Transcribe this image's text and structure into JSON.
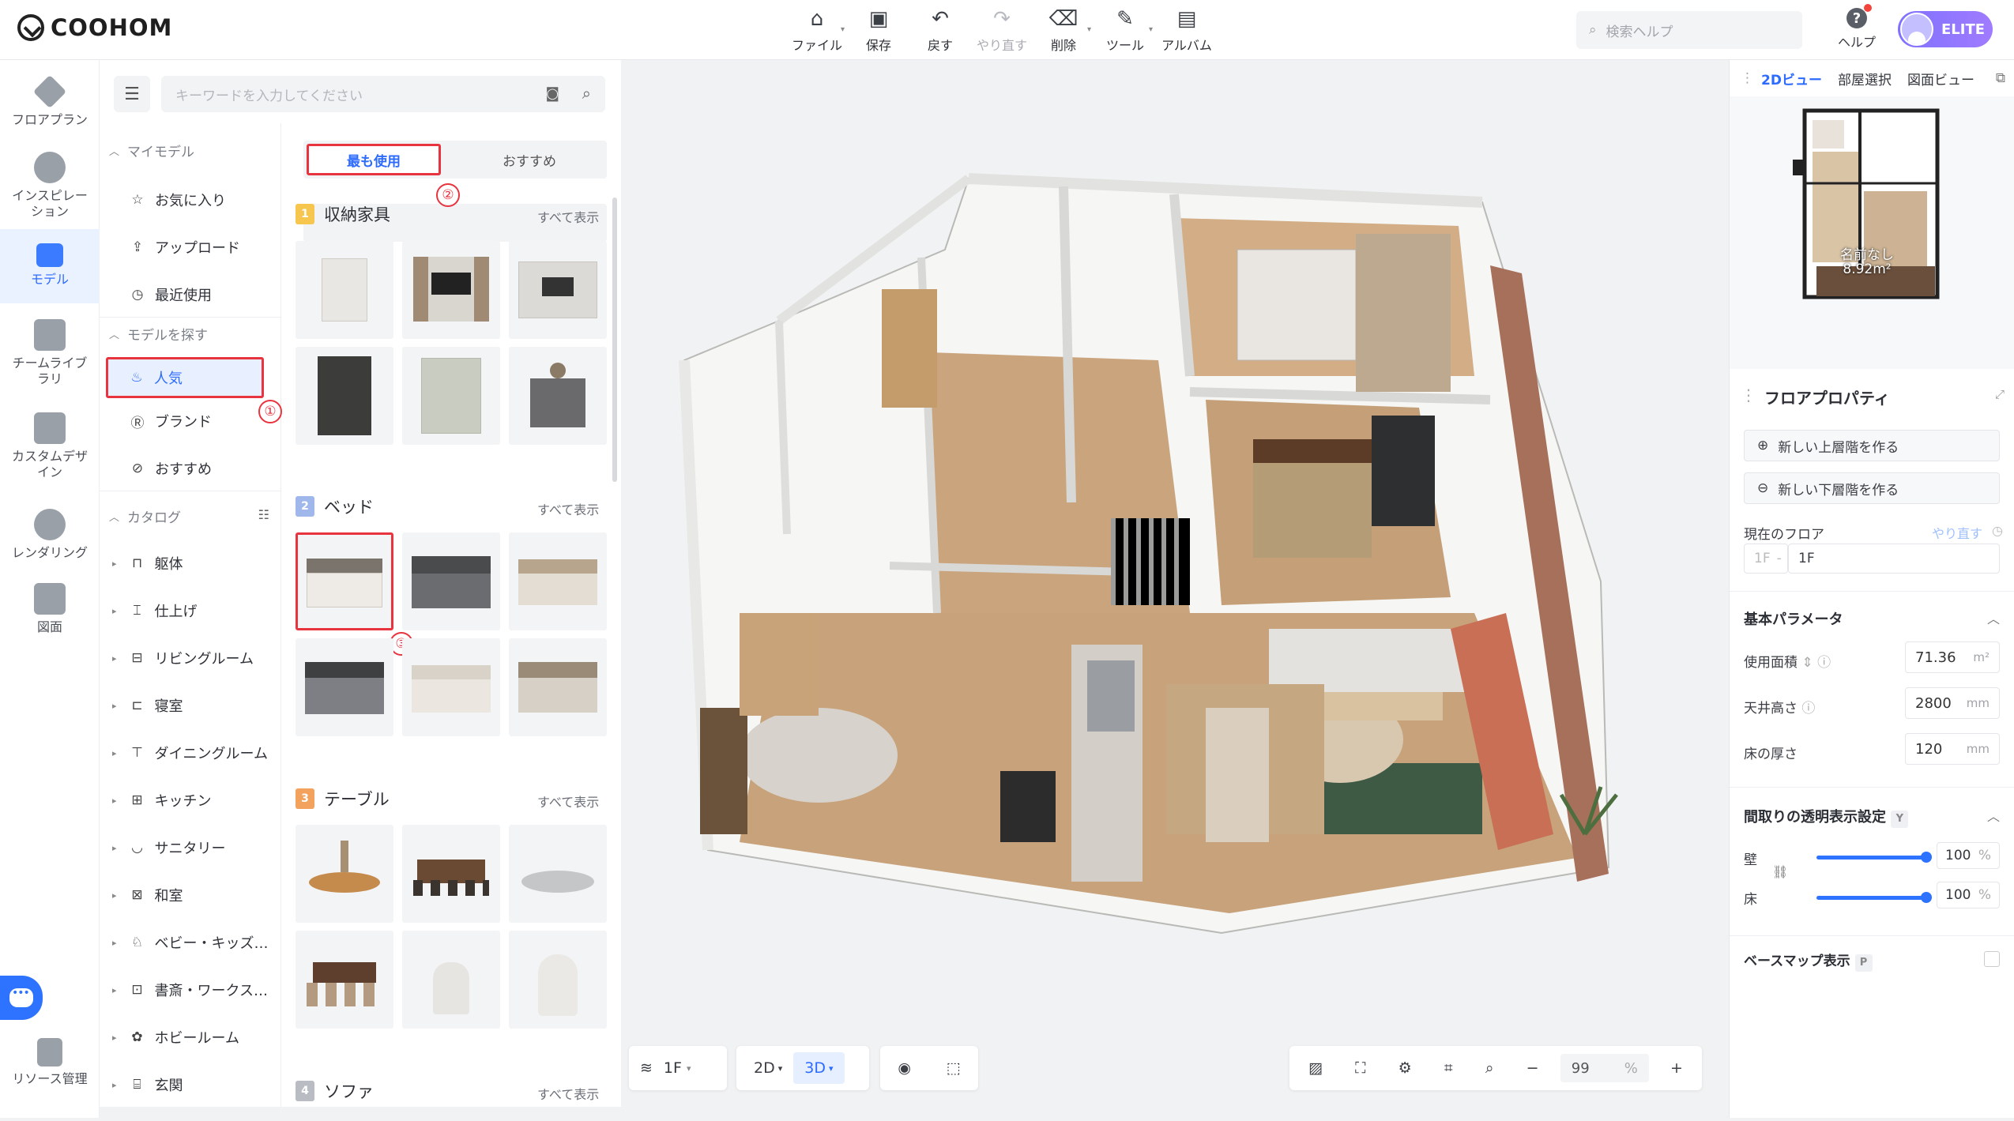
{
  "app": {
    "logo_text": "COOHOM"
  },
  "toolbar": {
    "items": [
      {
        "label": "ファイル",
        "icon": "home-file-icon",
        "dropdown": true,
        "disabled": false
      },
      {
        "label": "保存",
        "icon": "save-icon",
        "dropdown": false,
        "disabled": false
      },
      {
        "label": "戻す",
        "icon": "undo-icon",
        "dropdown": false,
        "disabled": false
      },
      {
        "label": "やり直す",
        "icon": "redo-icon",
        "dropdown": false,
        "disabled": true
      },
      {
        "label": "削除",
        "icon": "eraser-icon",
        "dropdown": true,
        "disabled": false
      },
      {
        "label": "ツール",
        "icon": "wrench-icon",
        "dropdown": true,
        "disabled": false
      },
      {
        "label": "アルバム",
        "icon": "album-icon",
        "dropdown": false,
        "disabled": false
      }
    ],
    "search_placeholder": "検索ヘルプ",
    "help_label": "ヘルプ",
    "badge": "ELITE"
  },
  "leftnav": {
    "items": [
      {
        "label": "フロアプラン",
        "icon": "floorplan-icon",
        "active": false
      },
      {
        "label": "インスピレーション",
        "icon": "lightbulb-icon",
        "active": false
      },
      {
        "label": "モデル",
        "icon": "sofa-icon",
        "active": true
      },
      {
        "label": "チームライブラリ",
        "icon": "crown-icon",
        "active": false
      },
      {
        "label": "カスタムデザイン",
        "icon": "box-icon",
        "active": false
      },
      {
        "label": "レンダリング",
        "icon": "camera-icon",
        "active": false
      },
      {
        "label": "図面",
        "icon": "drawing-icon",
        "active": false
      }
    ],
    "bottom_label": "リソース管理"
  },
  "panel": {
    "search_placeholder": "キーワードを入力してください",
    "sections": {
      "my_models": "マイモデル",
      "find_models": "モデルを探す",
      "catalog": "カタログ"
    },
    "my_items": [
      {
        "label": "お気に入り",
        "icon": "star-icon"
      },
      {
        "label": "アップロード",
        "icon": "upload-icon"
      },
      {
        "label": "最近使用",
        "icon": "clock-icon"
      }
    ],
    "find_items": [
      {
        "label": "人気",
        "icon": "flame-icon"
      },
      {
        "label": "ブランド",
        "icon": "brand-icon"
      },
      {
        "label": "おすすめ",
        "icon": "check-circle-icon"
      }
    ],
    "catalog_items": [
      {
        "label": "躯体",
        "icon": "structure-icon"
      },
      {
        "label": "仕上げ",
        "icon": "finish-icon"
      },
      {
        "label": "リビングルーム",
        "icon": "sofa-icon"
      },
      {
        "label": "寝室",
        "icon": "bed-icon"
      },
      {
        "label": "ダイニングルーム",
        "icon": "dining-icon"
      },
      {
        "label": "キッチン",
        "icon": "kitchen-icon"
      },
      {
        "label": "サニタリー",
        "icon": "bath-icon"
      },
      {
        "label": "和室",
        "icon": "japanese-room-icon"
      },
      {
        "label": "ベビー・キッズ…",
        "icon": "baby-icon"
      },
      {
        "label": "書斎・ワークス…",
        "icon": "desk-icon"
      },
      {
        "label": "ホビールーム",
        "icon": "hobby-icon"
      },
      {
        "label": "玄関",
        "icon": "door-icon"
      }
    ],
    "annotations": [
      "①",
      "②",
      "③"
    ],
    "tabs": [
      "最も使用",
      "おすすめ"
    ],
    "view_all": "すべて表示",
    "groups": [
      {
        "num": "1",
        "title": "収納家具",
        "color": "#f6c64e"
      },
      {
        "num": "2",
        "title": "ベッド",
        "color": "#9fb7ea"
      },
      {
        "num": "3",
        "title": "テーブル",
        "color": "#f2a25d"
      },
      {
        "num": "4",
        "title": "ソファ",
        "color": "#b9bcc3"
      }
    ]
  },
  "canvas": {
    "floor": "1F",
    "view_2d": "2D",
    "view_3d": "3D",
    "zoom": "99",
    "zoom_unit": "%"
  },
  "right": {
    "tabs": [
      "2Dビュー",
      "部屋選択",
      "図面ビュー"
    ],
    "minimap_label": "名前なし",
    "minimap_area": "8.92m²",
    "title": "フロアプロパティ",
    "btn_upper": "新しい上層階を作る",
    "btn_lower": "新しい下層階を作る",
    "current_floor_label": "現在のフロア",
    "redo_link": "やり直す",
    "floor_prefix": "1F",
    "floor_name": "1F",
    "basic_params": "基本パラメータ",
    "area_label": "使用面積",
    "area_value": "71.36",
    "area_unit": "m²",
    "ceiling_label": "天井高さ",
    "ceiling_value": "2800",
    "ceiling_unit": "mm",
    "floor_thick_label": "床の厚さ",
    "floor_thick_value": "120",
    "floor_thick_unit": "mm",
    "transparency_label": "間取りの透明表示設定",
    "transparency_key": "Y",
    "wall_label": "壁",
    "wall_value": "100",
    "wall_level": 1.0,
    "floor_label": "床",
    "floor_value": "100",
    "floor_level": 1.0,
    "pct": "%",
    "basemap_label": "ベースマップ表示",
    "basemap_key": "P"
  }
}
